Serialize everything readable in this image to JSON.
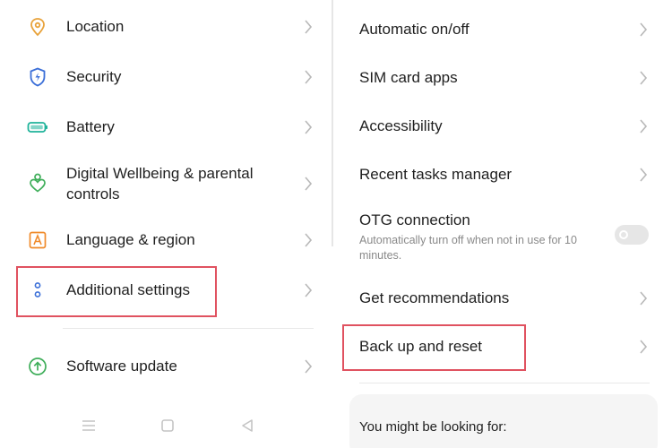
{
  "left": {
    "items": [
      {
        "label": "Location",
        "icon": "location-pin-icon",
        "color": "#e8a23a"
      },
      {
        "label": "Security",
        "icon": "shield-icon",
        "color": "#3b6fd8"
      },
      {
        "label": "Battery",
        "icon": "battery-icon",
        "color": "#1fb39a"
      },
      {
        "label": "Digital Wellbeing & parental",
        "label2": "controls",
        "icon": "wellbeing-heart-icon",
        "color": "#3fae5a"
      },
      {
        "label": "Language & region",
        "icon": "language-a-icon",
        "color": "#f08a2a"
      },
      {
        "label": "Additional settings",
        "icon": "more-dots-icon",
        "color": "#3b6fd8"
      },
      {
        "label": "Software update",
        "icon": "update-arrow-icon",
        "color": "#3fae5a"
      }
    ]
  },
  "right": {
    "items": [
      {
        "label": "Automatic on/off"
      },
      {
        "label": "SIM card apps"
      },
      {
        "label": "Accessibility"
      },
      {
        "label": "Recent tasks manager"
      },
      {
        "label": "OTG connection",
        "sublabel": "Automatically turn off when not in use for 10 minutes.",
        "toggle_on": false
      },
      {
        "label": "Get recommendations"
      },
      {
        "label": "Back up and reset"
      }
    ],
    "card_title": "You might be looking for:"
  },
  "nav": [
    "menu-lines-icon",
    "home-square-icon",
    "back-triangle-icon"
  ],
  "colors": {
    "highlight": "#e05260",
    "chevron": "#b8b8b8",
    "nav": "#c4c4c4"
  }
}
